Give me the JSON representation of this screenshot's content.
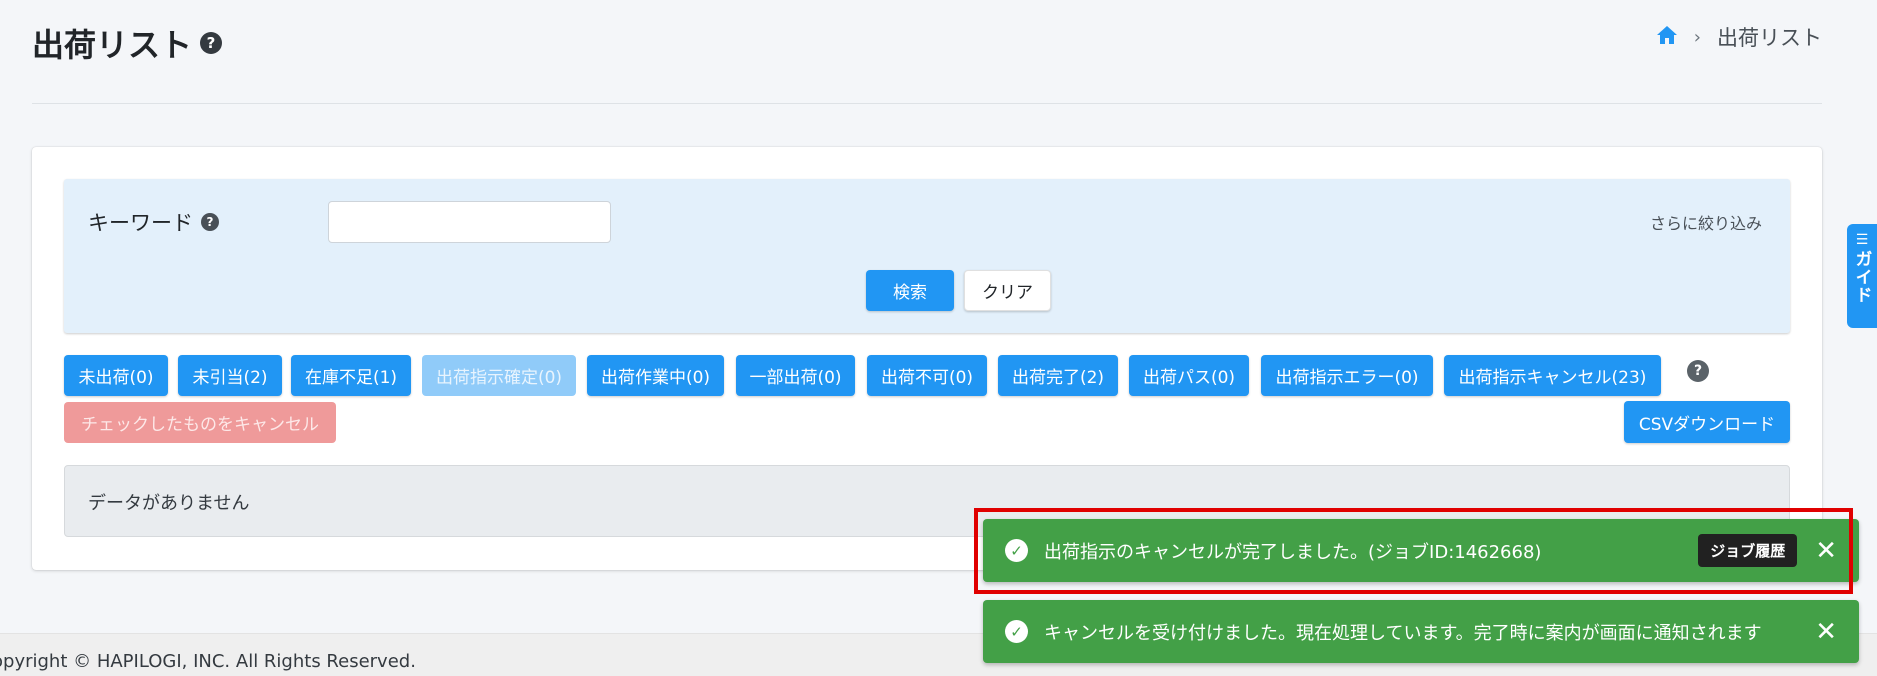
{
  "header": {
    "title": "出荷リスト",
    "help": "?",
    "breadcrumb": {
      "home_icon": "home-icon",
      "separator": "›",
      "current": "出荷リスト"
    }
  },
  "search": {
    "keyword_label": "キーワード",
    "keyword_help": "?",
    "keyword_value": "",
    "more_filter": "さらに絞り込み",
    "search_button": "検索",
    "clear_button": "クリア"
  },
  "status_buttons": [
    {
      "label": "未出荷(0)",
      "disabled": false
    },
    {
      "label": "未引当(2)",
      "disabled": false
    },
    {
      "label": "在庫不足(1)",
      "disabled": false
    },
    {
      "label": "出荷指示確定(0)",
      "disabled": true
    },
    {
      "label": "出荷作業中(0)",
      "disabled": false
    },
    {
      "label": "一部出荷(0)",
      "disabled": false
    },
    {
      "label": "出荷不可(0)",
      "disabled": false
    },
    {
      "label": "出荷完了(2)",
      "disabled": false
    },
    {
      "label": "出荷パス(0)",
      "disabled": false
    },
    {
      "label": "出荷指示エラー(0)",
      "disabled": false
    },
    {
      "label": "出荷指示キャンセル(23)",
      "disabled": false
    }
  ],
  "status_help": "?",
  "actions": {
    "cancel_checked": "チェックしたものをキャンセル",
    "csv_download": "CSVダウンロード"
  },
  "empty_message": "データがありません",
  "footer": {
    "copyright": "opyright © HAPILOGI, INC. All Rights Reserved."
  },
  "guide_tab": {
    "label": "ガイド",
    "icon": "guide-list-icon"
  },
  "toasts": [
    {
      "message": "出荷指示のキャンセルが完了しました。(ジョブID:1462668)",
      "button": "ジョブ履歴",
      "icon": "check-circle-icon",
      "close": "✕"
    },
    {
      "message": "キャンセルを受け付けました。現在処理しています。完了時に案内が画面に通知されます",
      "icon": "check-circle-icon",
      "close": "✕"
    }
  ],
  "colors": {
    "primary": "#2196f3",
    "primary_disabled": "#90cbf9",
    "danger_disabled": "#ef9a9a",
    "success": "#43a047",
    "highlight": "#e00000"
  }
}
